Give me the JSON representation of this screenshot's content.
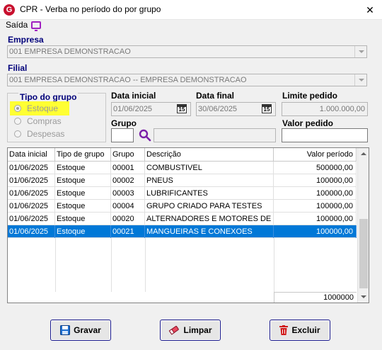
{
  "window": {
    "title": "CPR - Verba no período do por grupo",
    "close_glyph": "✕",
    "app_icon_letter": "G"
  },
  "menu": {
    "saida_label": "Saída"
  },
  "empresa": {
    "label": "Empresa",
    "value": "001 EMPRESA DEMONSTRACAO"
  },
  "filial": {
    "label": "Filial",
    "value": "001 EMPRESA DEMONSTRACAO -- EMPRESA DEMONSTRACAO"
  },
  "tipo_grupo": {
    "label": "Tipo do grupo",
    "options": [
      "Estoque",
      "Compras",
      "Despesas"
    ],
    "selected": "Estoque"
  },
  "data_inicial": {
    "label": "Data inicial",
    "value": "01/06/2025",
    "cal_label": "15"
  },
  "data_final": {
    "label": "Data final",
    "value": "30/06/2025",
    "cal_label": "15"
  },
  "limite_pedido": {
    "label": "Limite pedido",
    "value": "1.000.000,00"
  },
  "grupo": {
    "label": "Grupo",
    "code": "",
    "description": ""
  },
  "valor_pedido": {
    "label": "Valor pedido",
    "value": ""
  },
  "grid": {
    "columns": [
      "Data inicial",
      "Tipo de grupo",
      "Grupo",
      "Descrição",
      "Valor período"
    ],
    "rows": [
      [
        "01/06/2025",
        "Estoque",
        "00001",
        "COMBUSTIVEL",
        "500000,00"
      ],
      [
        "01/06/2025",
        "Estoque",
        "00002",
        "PNEUS",
        "100000,00"
      ],
      [
        "01/06/2025",
        "Estoque",
        "00003",
        "LUBRIFICANTES",
        "100000,00"
      ],
      [
        "01/06/2025",
        "Estoque",
        "00004",
        "GRUPO CRIADO PARA TESTES",
        "100000,00"
      ],
      [
        "01/06/2025",
        "Estoque",
        "00020",
        "ALTERNADORES E MOTORES DE P...",
        "100000,00"
      ],
      [
        "01/06/2025",
        "Estoque",
        "00021",
        "MANGUEIRAS E CONEXOES",
        "100000,00"
      ]
    ],
    "selected_row": 5,
    "total": "1000000"
  },
  "buttons": {
    "gravar": "Gravar",
    "limpar": "Limpar",
    "excluir": "Excluir"
  },
  "colors": {
    "accent_label": "#00007a",
    "selection": "#0078d7",
    "highlight": "#ffff33",
    "monitor_icon": "#a020c0"
  }
}
